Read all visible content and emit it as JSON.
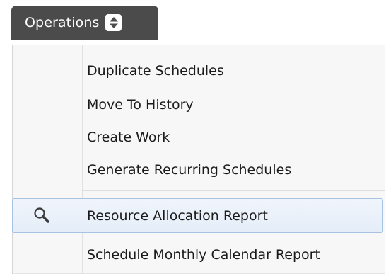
{
  "operations_button": {
    "label": "Operations",
    "icon": "updown-arrows-icon"
  },
  "menu": {
    "items": [
      {
        "label": "Duplicate Schedules",
        "icon": null
      },
      {
        "label": "Move To History",
        "icon": null
      },
      {
        "label": "Create Work",
        "icon": null
      },
      {
        "label": "Generate Recurring Schedules",
        "icon": null
      },
      {
        "label": "Resource Allocation Report",
        "icon": "magnifier-icon",
        "highlighted": true
      },
      {
        "label": "Schedule Monthly Calendar Report",
        "icon": null
      }
    ]
  },
  "colors": {
    "button_bg": "#4b4b4b",
    "menu_bg": "#f7f7f7",
    "hover_border": "#a7c2e3",
    "text": "#1b1b1b"
  }
}
